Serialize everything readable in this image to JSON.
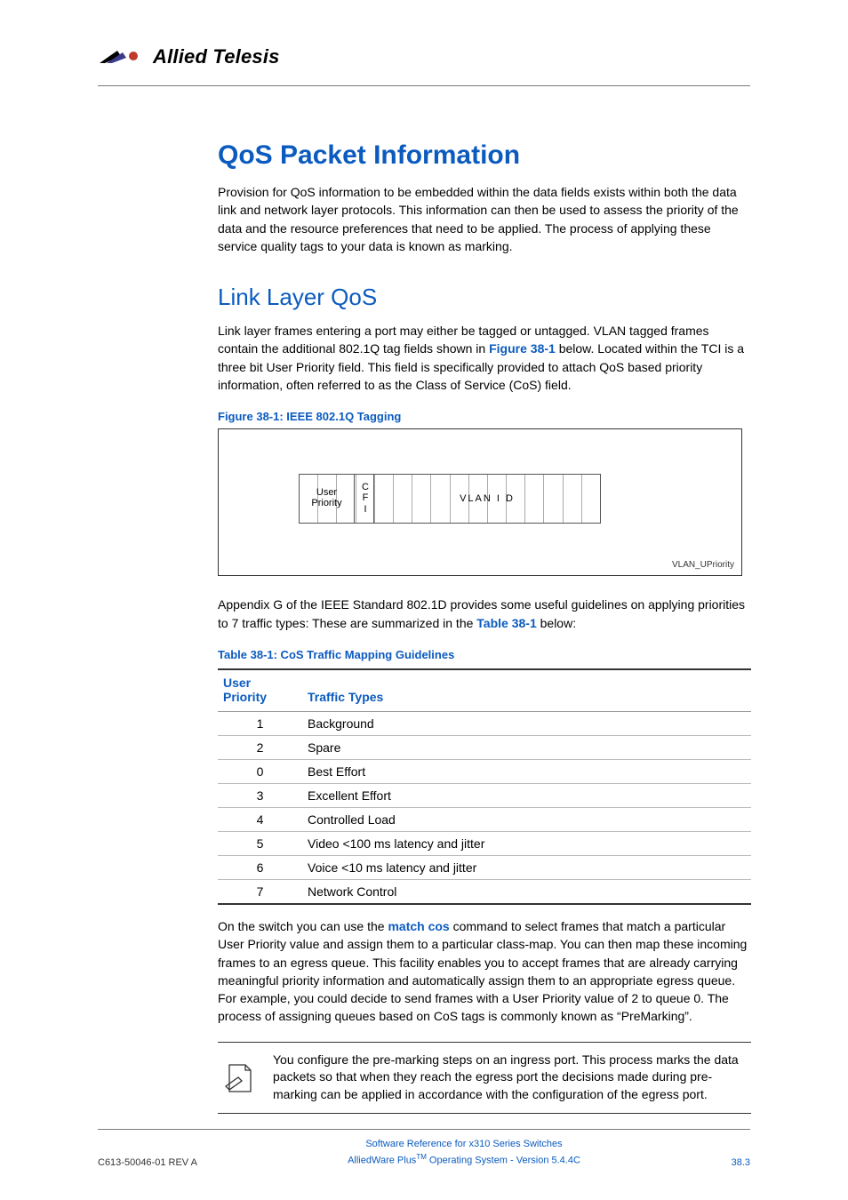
{
  "brand": {
    "name": "Allied Telesis"
  },
  "h1": "QoS Packet Information",
  "p1": "Provision for QoS information to be embedded within the data fields exists within both the data link and network layer protocols. This information can then be used to assess the priority of the data and the resource preferences that need to be applied. The process of applying these service quality tags to your data is known as marking.",
  "h2": "Link Layer QoS",
  "p2a": "Link layer frames entering a port may either be tagged or untagged. VLAN tagged frames contain the additional 802.1Q tag fields shown in ",
  "p2_link": "Figure 38-1",
  "p2b": " below. Located within the TCI is a three bit User Priority field. This field is specifically provided to attach QoS based priority information, often referred to as the Class of Service (CoS) field.",
  "fig": {
    "caption": "Figure 38-1: IEEE 802.1Q Tagging",
    "labels": {
      "user": "User Priority",
      "cfi": "C F I",
      "vlan": "VLAN I D"
    },
    "foot": "VLAN_UPriority"
  },
  "p3a": "Appendix G of the IEEE Standard 802.1D provides some useful guidelines on applying priorities to 7 traffic types: These are summarized in the ",
  "p3_link": "Table 38-1",
  "p3b": " below:",
  "table": {
    "caption": "Table 38-1: CoS Traffic Mapping Guidelines",
    "head": {
      "up": "User Priority",
      "tt": "Traffic Types"
    },
    "rows": [
      {
        "up": "1",
        "tt": "Background"
      },
      {
        "up": "2",
        "tt": "Spare"
      },
      {
        "up": "0",
        "tt": "Best Effort"
      },
      {
        "up": "3",
        "tt": "Excellent Effort"
      },
      {
        "up": "4",
        "tt": "Controlled Load"
      },
      {
        "up": "5",
        "tt": "Video <100 ms latency and jitter"
      },
      {
        "up": "6",
        "tt": "Voice <10 ms latency and jitter"
      },
      {
        "up": "7",
        "tt": "Network Control"
      }
    ]
  },
  "p4a": "On the switch you can use the ",
  "p4_cmd": "match cos",
  "p4b": " command to select frames that match a particular User Priority value and assign them to a particular class-map. You can then map these incoming frames to an egress queue. This facility enables you to accept frames that are already carrying meaningful priority information and automatically assign them to an appropriate egress queue. For example, you could decide to send frames with a User Priority value of 2 to queue 0. The process of assigning queues based on CoS tags is commonly known as “PreMarking”.",
  "note": "You configure the pre-marking steps on an ingress port. This process marks the data packets so that when they reach the egress port the decisions made during pre-marking can be applied in accordance with the configuration of the egress port.",
  "footer": {
    "left": "C613-50046-01 REV A",
    "center1": "Software Reference for x310 Series Switches",
    "center2a": "AlliedWare Plus",
    "center2tm": "TM",
    "center2b": " Operating System - Version 5.4.4C",
    "right": "38.3"
  }
}
